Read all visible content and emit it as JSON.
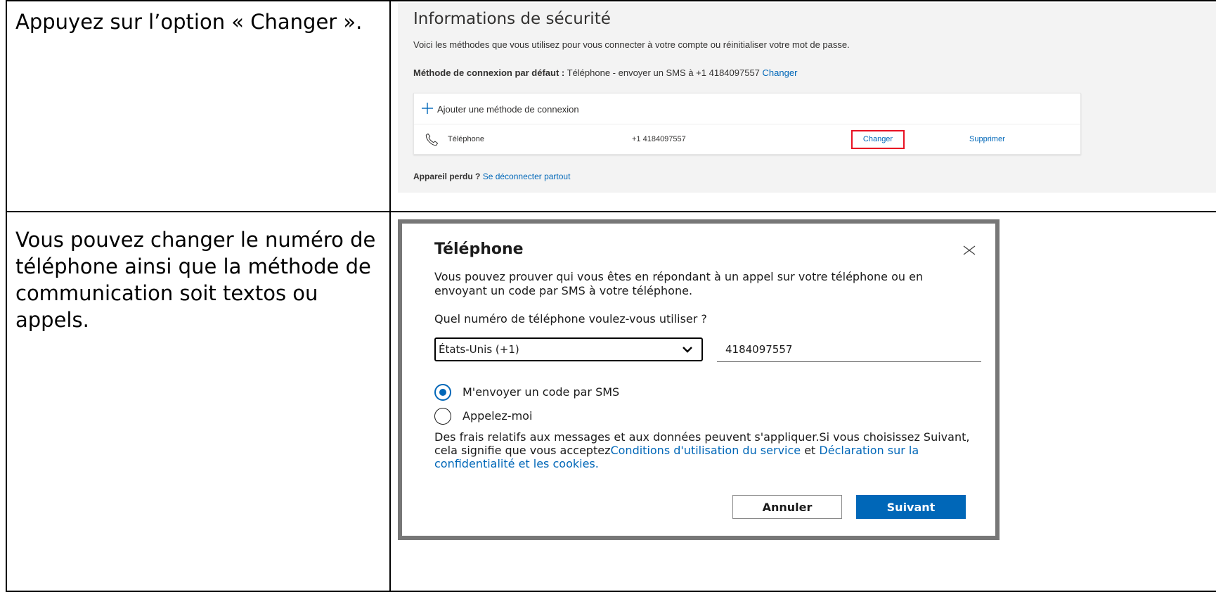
{
  "instructions": {
    "step1": "Appuyez sur l’option « Changer ».",
    "step2": "Vous pouvez changer le numéro de téléphone ainsi que la méthode de communication soit textos ou appels."
  },
  "security_page": {
    "title": "Informations de sécurité",
    "description": "Voici les méthodes que vous utilisez pour vous connecter à votre compte ou réinitialiser votre mot de passe.",
    "default_method_label": "Méthode de connexion par défaut :",
    "default_method_value": " Téléphone - envoyer un SMS à +1 4184097557 ",
    "default_method_change": "Changer",
    "add_method_label": "Ajouter une méthode de connexion",
    "methods": [
      {
        "icon": "phone-icon",
        "label": "Téléphone",
        "value": "+1 4184097557",
        "change_label": "Changer",
        "delete_label": "Supprimer"
      }
    ],
    "lost_device_label": "Appareil perdu ?",
    "lost_device_link": "Se déconnecter partout",
    "highlight_color": "#e81123"
  },
  "phone_dialog": {
    "title": "Téléphone",
    "description": "Vous pouvez prouver qui vous êtes en répondant à un appel sur votre téléphone ou en envoyant un code par SMS à votre téléphone.",
    "question": "Quel numéro de téléphone voulez-vous utiliser ?",
    "country_selected": "États-Unis (+1)",
    "phone_value": "4184097557",
    "options": [
      {
        "label": "M'envoyer un code par SMS",
        "checked": true
      },
      {
        "label": "Appelez-moi",
        "checked": false
      }
    ],
    "disclaimer_text": "Des frais relatifs aux messages et aux données peuvent s'appliquer.Si vous choisissez Suivant, cela signifie que vous acceptez",
    "terms_link": "Conditions d'utilisation du service",
    "and_text": " et ",
    "privacy_link": "Déclaration sur la confidentialité et les cookies.",
    "cancel_label": "Annuler",
    "next_label": "Suivant",
    "accent_color": "#0067b8"
  }
}
